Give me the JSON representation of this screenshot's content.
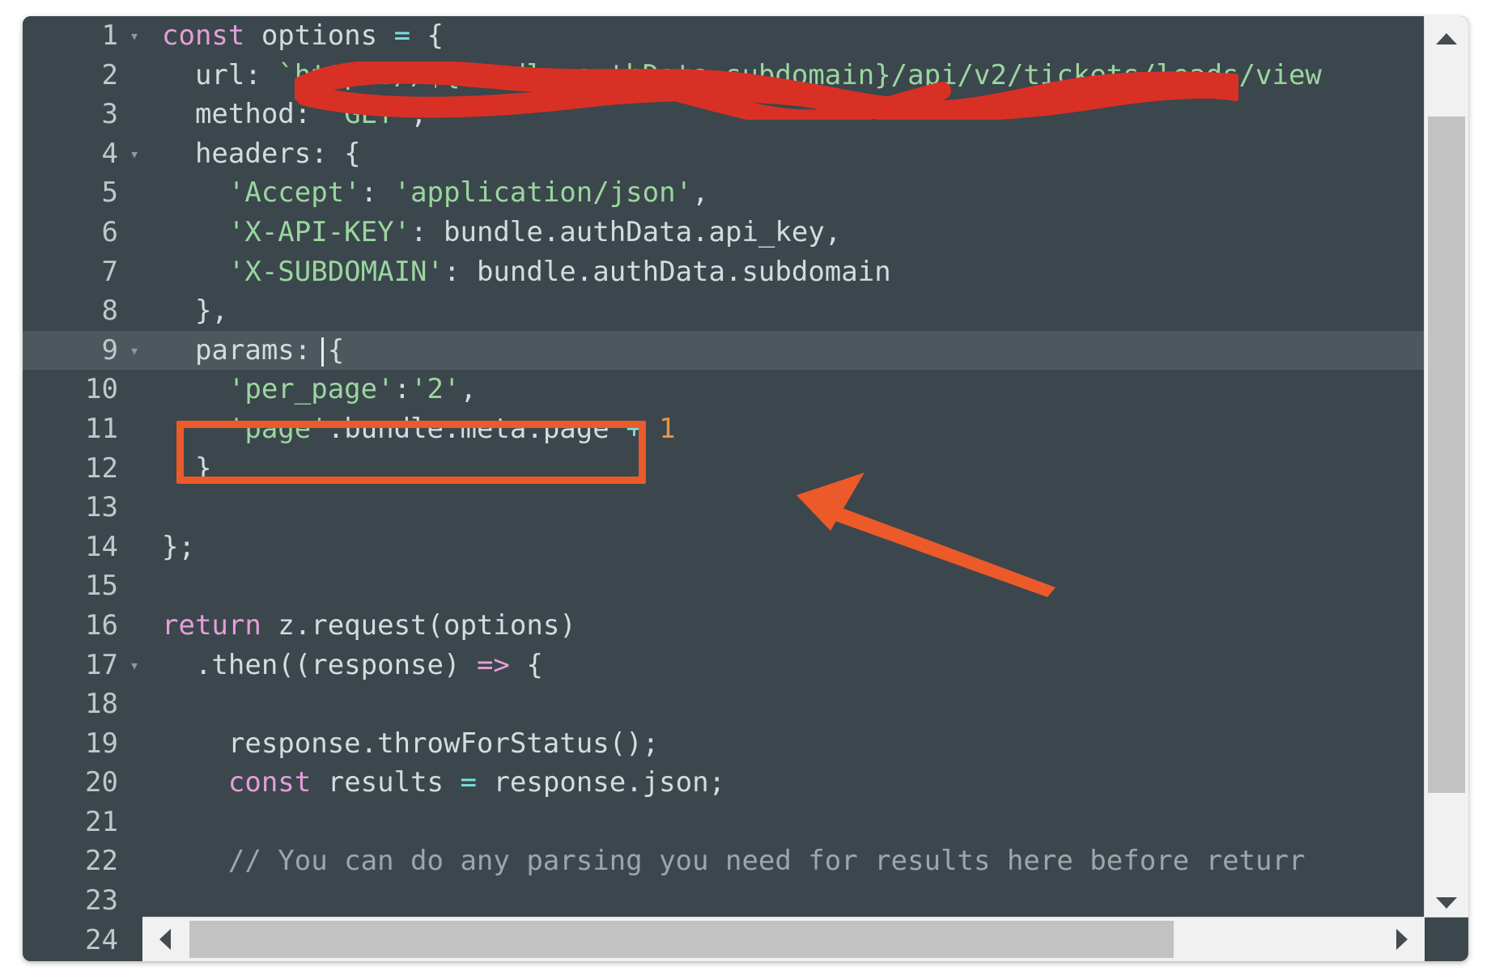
{
  "editor": {
    "theme_background": "#3b474c",
    "active_line_background": "#4c585d",
    "gutter_number_color": "#c0c7c9",
    "lines": [
      {
        "num": "1",
        "foldable": true,
        "active": false,
        "text": "const options = {"
      },
      {
        "num": "2",
        "foldable": false,
        "active": false,
        "text": "  url: `https://${bundle.authData.subdomain}/api/v2/tickets/leads/view"
      },
      {
        "num": "3",
        "foldable": false,
        "active": false,
        "text": "  method: 'GET',"
      },
      {
        "num": "4",
        "foldable": true,
        "active": false,
        "text": "  headers: {"
      },
      {
        "num": "5",
        "foldable": false,
        "active": false,
        "text": "    'Accept': 'application/json',"
      },
      {
        "num": "6",
        "foldable": false,
        "active": false,
        "text": "    'X-API-KEY': bundle.authData.api_key,"
      },
      {
        "num": "7",
        "foldable": false,
        "active": false,
        "text": "    'X-SUBDOMAIN': bundle.authData.subdomain"
      },
      {
        "num": "8",
        "foldable": false,
        "active": false,
        "text": "  },"
      },
      {
        "num": "9",
        "foldable": true,
        "active": true,
        "text": "  params: {"
      },
      {
        "num": "10",
        "foldable": false,
        "active": false,
        "text": "    'per_page':'2',"
      },
      {
        "num": "11",
        "foldable": false,
        "active": false,
        "text": "    'page':bundle.meta.page + 1"
      },
      {
        "num": "12",
        "foldable": false,
        "active": false,
        "text": "  }"
      },
      {
        "num": "13",
        "foldable": false,
        "active": false,
        "text": ""
      },
      {
        "num": "14",
        "foldable": false,
        "active": false,
        "text": "};"
      },
      {
        "num": "15",
        "foldable": false,
        "active": false,
        "text": ""
      },
      {
        "num": "16",
        "foldable": false,
        "active": false,
        "text": "return z.request(options)"
      },
      {
        "num": "17",
        "foldable": true,
        "active": false,
        "text": "  .then((response) => {"
      },
      {
        "num": "18",
        "foldable": false,
        "active": false,
        "text": ""
      },
      {
        "num": "19",
        "foldable": false,
        "active": false,
        "text": "    response.throwForStatus();"
      },
      {
        "num": "20",
        "foldable": false,
        "active": false,
        "text": "    const results = response.json;"
      },
      {
        "num": "21",
        "foldable": false,
        "active": false,
        "text": ""
      },
      {
        "num": "22",
        "foldable": false,
        "active": false,
        "text": "    // You can do any parsing you need for results here before returr"
      },
      {
        "num": "23",
        "foldable": false,
        "active": false,
        "text": ""
      },
      {
        "num": "24",
        "foldable": false,
        "active": false,
        "text": ""
      }
    ],
    "line_tokens": {
      "l1": [
        {
          "t": "const",
          "c": "tok-kw"
        },
        {
          "t": " options ",
          "c": "tok-plain"
        },
        {
          "t": "=",
          "c": "tok-op"
        },
        {
          "t": " {",
          "c": "tok-plain"
        }
      ],
      "l2": [
        {
          "t": "  url: ",
          "c": "tok-plain"
        },
        {
          "t": "`https://${bundle.authData.subdomain}/api/v2/tickets/leads/view",
          "c": "tok-str"
        }
      ],
      "l3": [
        {
          "t": "  method: ",
          "c": "tok-plain"
        },
        {
          "t": "'GET'",
          "c": "tok-str"
        },
        {
          "t": ",",
          "c": "tok-plain"
        }
      ],
      "l4": [
        {
          "t": "  headers: {",
          "c": "tok-plain"
        }
      ],
      "l5": [
        {
          "t": "    ",
          "c": "tok-plain"
        },
        {
          "t": "'Accept'",
          "c": "tok-str"
        },
        {
          "t": ": ",
          "c": "tok-plain"
        },
        {
          "t": "'application/json'",
          "c": "tok-str"
        },
        {
          "t": ",",
          "c": "tok-plain"
        }
      ],
      "l6": [
        {
          "t": "    ",
          "c": "tok-plain"
        },
        {
          "t": "'X-API-KEY'",
          "c": "tok-str"
        },
        {
          "t": ": bundle.authData.api_key,",
          "c": "tok-plain"
        }
      ],
      "l7": [
        {
          "t": "    ",
          "c": "tok-plain"
        },
        {
          "t": "'X-SUBDOMAIN'",
          "c": "tok-str"
        },
        {
          "t": ": bundle.authData.subdomain",
          "c": "tok-plain"
        }
      ],
      "l8": [
        {
          "t": "  },",
          "c": "tok-plain"
        }
      ],
      "l9": [
        {
          "t": "  params: {",
          "c": "tok-plain"
        }
      ],
      "l10": [
        {
          "t": "    ",
          "c": "tok-plain"
        },
        {
          "t": "'per_page'",
          "c": "tok-str"
        },
        {
          "t": ":",
          "c": "tok-plain"
        },
        {
          "t": "'2'",
          "c": "tok-str"
        },
        {
          "t": ",",
          "c": "tok-plain"
        }
      ],
      "l11": [
        {
          "t": "    ",
          "c": "tok-plain"
        },
        {
          "t": "'page'",
          "c": "tok-str"
        },
        {
          "t": ":bundle.meta.page ",
          "c": "tok-plain"
        },
        {
          "t": "+",
          "c": "tok-op"
        },
        {
          "t": " ",
          "c": "tok-plain"
        },
        {
          "t": "1",
          "c": "tok-num"
        }
      ],
      "l12": [
        {
          "t": "  }",
          "c": "tok-plain"
        }
      ],
      "l13": [],
      "l14": [
        {
          "t": "};",
          "c": "tok-plain"
        }
      ],
      "l15": [],
      "l16": [
        {
          "t": "return",
          "c": "tok-kw"
        },
        {
          "t": " z.request(options)",
          "c": "tok-plain"
        }
      ],
      "l17": [
        {
          "t": "  .then((response) ",
          "c": "tok-plain"
        },
        {
          "t": "=>",
          "c": "tok-kw"
        },
        {
          "t": " {",
          "c": "tok-plain"
        }
      ],
      "l18": [],
      "l19": [
        {
          "t": "    response.throwForStatus();",
          "c": "tok-plain"
        }
      ],
      "l20": [
        {
          "t": "    ",
          "c": "tok-plain"
        },
        {
          "t": "const",
          "c": "tok-kw"
        },
        {
          "t": " results ",
          "c": "tok-plain"
        },
        {
          "t": "=",
          "c": "tok-op"
        },
        {
          "t": " response.json;",
          "c": "tok-plain"
        }
      ],
      "l21": [],
      "l22": [
        {
          "t": "    // You can do any parsing you need for results here before returr",
          "c": "tok-comment"
        }
      ],
      "l23": [],
      "l24": []
    }
  },
  "annotations": {
    "redaction": {
      "label": "red-scribble-redaction",
      "color": "#d93025",
      "covers_line": "2"
    },
    "highlight_box": {
      "label": "orange-highlight-box",
      "color": "#ec5a29",
      "targets_line": "11",
      "target_text": "'page':bundle.meta.page + 1"
    },
    "pointer_arrow": {
      "label": "orange-pointer-arrow",
      "color": "#ec5a29",
      "direction": "up-left"
    }
  },
  "scrollbars": {
    "vertical": {
      "up_arrow": "▲",
      "down_arrow": "▼",
      "track_color": "#f1f1f1",
      "thumb_color": "#c2c2c2"
    },
    "horizontal": {
      "left_arrow": "◀",
      "right_arrow": "▶",
      "track_color": "#f1f1f1",
      "thumb_color": "#c2c2c2"
    }
  }
}
